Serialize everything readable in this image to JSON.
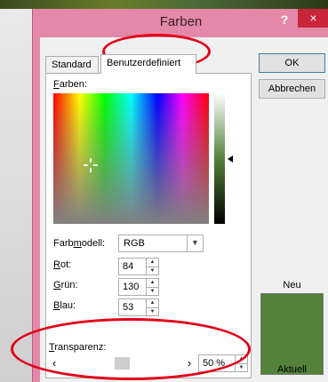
{
  "window": {
    "title": "Farben",
    "help": "?",
    "close": "×"
  },
  "tabs": {
    "standard": "Standard",
    "custom": "Benutzerdefiniert"
  },
  "colors_label": "Farben:",
  "color_model": {
    "label": "Farbmodell:",
    "value": "RGB"
  },
  "rgb": {
    "red": {
      "label": "Rot:",
      "value": "84"
    },
    "green": {
      "label": "Grün:",
      "value": "130"
    },
    "blue": {
      "label": "Blau:",
      "value": "53"
    }
  },
  "transparency": {
    "label": "Transparenz:",
    "value_text": "50 %",
    "slider_fraction": 0.5
  },
  "buttons": {
    "ok": "OK",
    "cancel": "Abbrechen"
  },
  "preview": {
    "new_label": "Neu",
    "current_label": "Aktuell",
    "new_color": "#54823a",
    "current_color": "#54823a"
  },
  "icons": {
    "scroll_left": "‹",
    "scroll_right": "›",
    "dropdown": "▼",
    "up": "▲",
    "down": "▼"
  },
  "annotation_color": "#e2001a"
}
